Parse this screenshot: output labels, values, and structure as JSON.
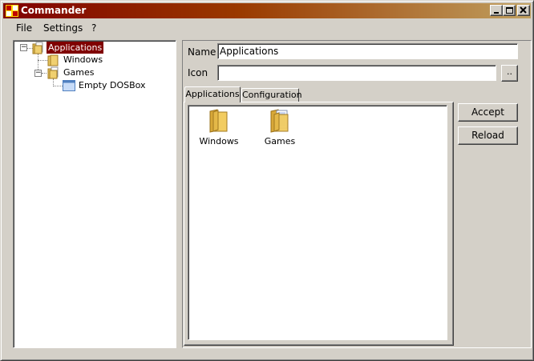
{
  "window": {
    "title": "Commander",
    "accent_color": "#800000"
  },
  "menu": {
    "items": [
      "File",
      "Settings",
      "?"
    ]
  },
  "tree": {
    "root": {
      "label": "Applications",
      "expanded": true,
      "selected": true,
      "children": [
        {
          "label": "Windows"
        },
        {
          "label": "Games",
          "expanded": true,
          "children": [
            {
              "label": "Empty DOSBox"
            }
          ]
        }
      ]
    }
  },
  "form": {
    "name_label": "Name",
    "name_value": "Applications",
    "icon_label": "Icon",
    "icon_value": "",
    "browse_label": ".."
  },
  "tabs": [
    {
      "label": "Applications",
      "active": true
    },
    {
      "label": "Configuration",
      "active": false
    }
  ],
  "listview": {
    "items": [
      {
        "label": "Windows",
        "icon": "folder-icon"
      },
      {
        "label": "Games",
        "icon": "folder-open-icon"
      }
    ]
  },
  "buttons": {
    "accept_label": "Accept",
    "reload_label": "Reload"
  }
}
